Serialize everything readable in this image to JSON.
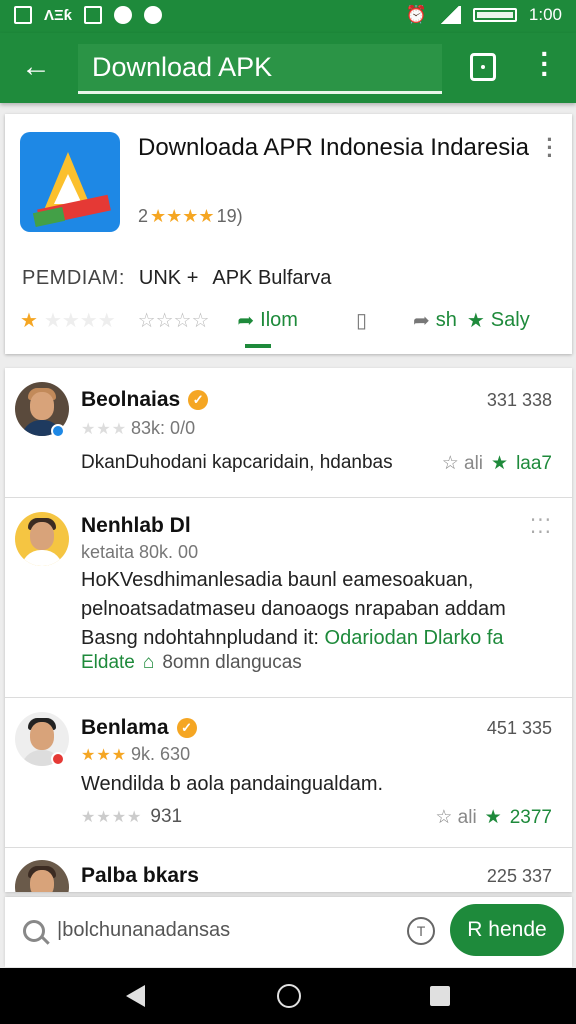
{
  "status_bar": {
    "left_text": "ΛΞƙ",
    "time": "1:00"
  },
  "app_bar": {
    "search_value": "Download APK"
  },
  "app": {
    "title": "Downloada APR Indonesia Indaresia",
    "rating_prefix": "2",
    "rating_stars": "★★★★",
    "rating_count": "19)",
    "info_label": "PEMDIAM:",
    "info_value1": "UNK +",
    "info_value2": "APK Bulfarva",
    "actions": {
      "rating_stars_1": "★★★★",
      "rating_stars_2": "☆☆☆☆",
      "share_label": "Ilom",
      "bookmark_icon": "bookmark-icon",
      "share2_label": "sh",
      "save_label": "Saly"
    }
  },
  "reviews": [
    {
      "name": "Beolnaias",
      "count": "331 338",
      "stars": "★★★",
      "meta": "83k: 0/0",
      "text": "",
      "foot_text": "DkanDuhodani kapcaridain, hdanbas",
      "foot_icons": "☆ ali",
      "foot_count": "laa7"
    },
    {
      "name": "Nenhlab Dl",
      "count": "⁚⁚⁚",
      "stars": "",
      "meta": "ketaita 80k. 00",
      "text": "HoKVesdhimanlesadia baunl eamesoakuan, pelnoatsadatmaseu danoaogs nrapaban addam Basng ndohtahnpludand it:",
      "link_text": "Odariodan Dlarko fa",
      "foot_text": "Eldate",
      "foot_extra": "8omn dlangucas"
    },
    {
      "name": "Benlama",
      "count": "451 335",
      "stars": "★★★",
      "meta": "9k. 630",
      "text": "Wendilda b aola pandaingualdam.",
      "foot_stars": "★★★★",
      "foot_count_left": "931",
      "foot_icons": "☆ ali",
      "foot_count": "2377"
    },
    {
      "name": "Palba bkars",
      "count": "225 337",
      "stars": "",
      "meta": "",
      "text": ""
    }
  ],
  "bottom_search": {
    "placeholder": "|bolchunanadansas",
    "button_label": "R hende"
  },
  "colors": {
    "primary": "#1e8a3b",
    "star": "#f5a623"
  }
}
